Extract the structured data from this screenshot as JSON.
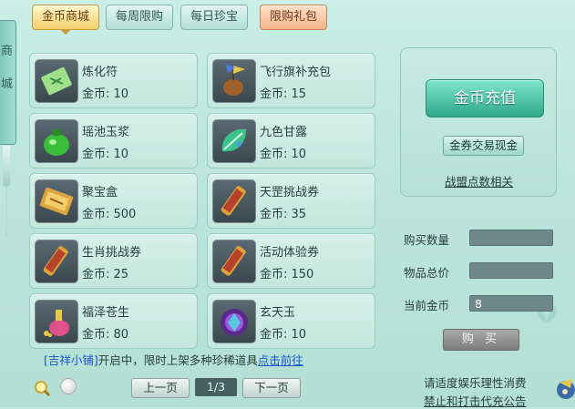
{
  "tabs": [
    {
      "label": "金币商城",
      "active": true
    },
    {
      "label": "每周限购",
      "active": false
    },
    {
      "label": "每日珍宝",
      "active": false
    },
    {
      "label": "限购礼包",
      "active": false
    }
  ],
  "side_banner": {
    "char1": "商",
    "char2": "城"
  },
  "items": [
    {
      "name": "炼化符",
      "price": "金币: 10",
      "icon": "talisman-icon"
    },
    {
      "name": "飞行旗补充包",
      "price": "金币: 15",
      "icon": "flag-bag-icon"
    },
    {
      "name": "瑶池玉浆",
      "price": "金币: 10",
      "icon": "jade-jar-icon"
    },
    {
      "name": "九色甘露",
      "price": "金币: 10",
      "icon": "dew-leaf-icon"
    },
    {
      "name": "聚宝盒",
      "price": "金币: 500",
      "icon": "treasure-box-icon"
    },
    {
      "name": "天罡挑战券",
      "price": "金币: 35",
      "icon": "scroll-icon"
    },
    {
      "name": "生肖挑战券",
      "price": "金币: 25",
      "icon": "scroll-icon"
    },
    {
      "name": "活动体验券",
      "price": "金币: 150",
      "icon": "scroll-icon"
    },
    {
      "name": "福泽苍生",
      "price": "金币: 80",
      "icon": "potion-icon"
    },
    {
      "name": "玄天玉",
      "price": "金币: 10",
      "icon": "purple-gem-icon"
    }
  ],
  "notice": {
    "prefix": "[吉祥小铺]",
    "text": "开启中，限时上架多种珍稀道具",
    "link": "点击前往"
  },
  "pagination": {
    "prev": "上一页",
    "page": "1/3",
    "next": "下一页"
  },
  "right": {
    "recharge": "金币充值",
    "exchange": "金券交易现金",
    "guild": "战盟点数相关",
    "buy_qty_label": "购买数量",
    "buy_qty_value": "",
    "total_label": "物品总价",
    "total_value": "",
    "gold_label": "当前金币",
    "gold_value": "8",
    "buy": "购 买"
  },
  "footer": {
    "line1": "请适度娱乐理性消费",
    "line2": "禁止和打击代充公告"
  },
  "colors": {
    "accent": "#2fa88a",
    "active_tab": "#f2cf6c",
    "link": "#1d56c8"
  }
}
